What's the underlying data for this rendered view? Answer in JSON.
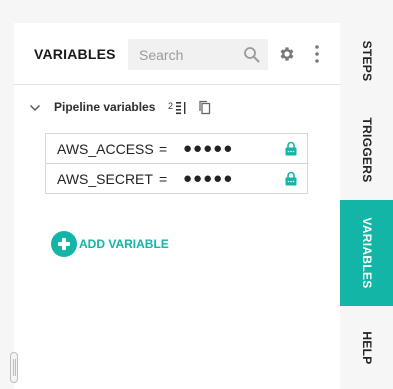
{
  "panel": {
    "title": "VARIABLES",
    "search": {
      "placeholder": "Search"
    }
  },
  "group": {
    "label": "Pipeline variables",
    "count": "2"
  },
  "variables": [
    {
      "name": "AWS_ACCESS",
      "equals": "=",
      "value": "●●●●●",
      "locked": true
    },
    {
      "name": "AWS_SECRET",
      "equals": "=",
      "value": "●●●●●",
      "locked": true
    }
  ],
  "add_button": {
    "label": "ADD VARIABLE"
  },
  "side_tabs": [
    {
      "label": "STEPS",
      "active": false
    },
    {
      "label": "TRIGGERS",
      "active": false
    },
    {
      "label": "VARIABLES",
      "active": true
    },
    {
      "label": "HELP",
      "active": false
    }
  ],
  "colors": {
    "accent": "#12b5a6",
    "icon": "#7a7a7a",
    "background": "#f6f6f6"
  },
  "icons": [
    "search-icon",
    "gear-icon",
    "more-vertical-icon",
    "chevron-down-icon",
    "sort-icon",
    "copy-icon",
    "lock-icon",
    "plus-circle-icon",
    "resize-handle"
  ]
}
